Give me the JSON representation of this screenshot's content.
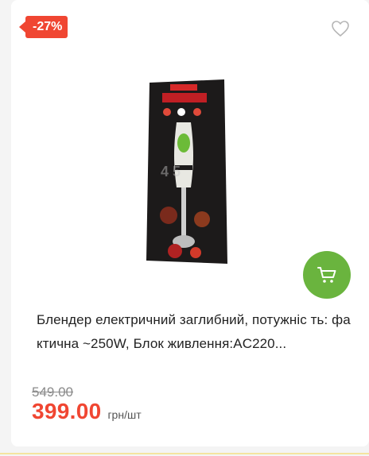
{
  "badge": {
    "discount": "-27%"
  },
  "product": {
    "title": "Блендер електричний заглибний, потужніс ть: фактична ~250W, Блок живлення:AC220...",
    "image": "hand-blender-package",
    "old_price": "549.00",
    "price": "399.00",
    "unit": "грн/шт"
  },
  "icons": {
    "wishlist": "heart-icon",
    "cart": "cart-icon"
  },
  "colors": {
    "accent_red": "#f04632",
    "cart_green": "#6ab43e"
  }
}
